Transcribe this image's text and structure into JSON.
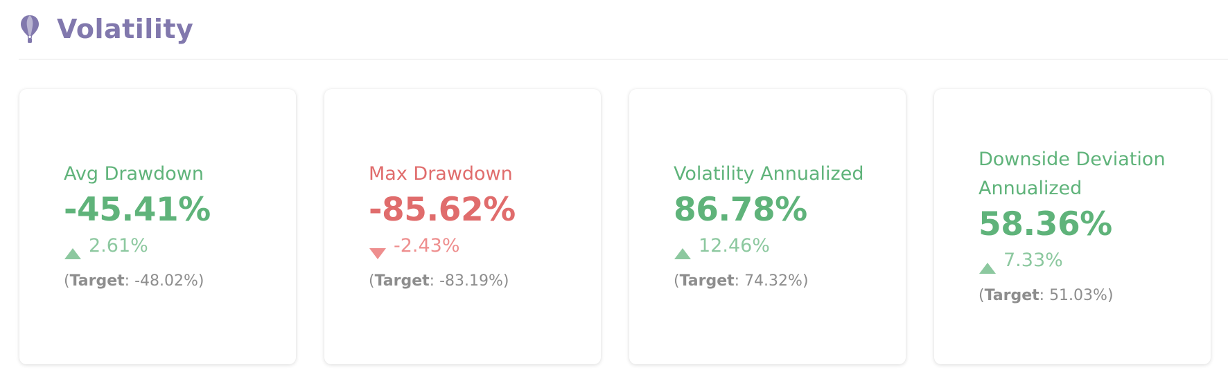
{
  "section": {
    "title": "Volatility",
    "icon": "hot-air-balloon-icon",
    "title_color": "#8178ad"
  },
  "colors": {
    "positive": "#5fb37a",
    "positive_light": "#8cc89f",
    "negative": "#e06c6c",
    "negative_light": "#ee8e8e",
    "muted": "#8d8d8d"
  },
  "cards": [
    {
      "label": "Avg Drawdown",
      "value": "-45.41%",
      "change": "2.61%",
      "change_direction": "up",
      "target_label": "Target",
      "target_value": "-48.02%",
      "tone": "positive"
    },
    {
      "label": "Max Drawdown",
      "value": "-85.62%",
      "change": "-2.43%",
      "change_direction": "down",
      "target_label": "Target",
      "target_value": "-83.19%",
      "tone": "negative"
    },
    {
      "label": "Volatility Annualized",
      "value": "86.78%",
      "change": "12.46%",
      "change_direction": "up",
      "target_label": "Target",
      "target_value": "74.32%",
      "tone": "positive"
    },
    {
      "label": "Downside Deviation Annualized",
      "value": "58.36%",
      "change": "7.33%",
      "change_direction": "up",
      "target_label": "Target",
      "target_value": "51.03%",
      "tone": "positive"
    }
  ]
}
